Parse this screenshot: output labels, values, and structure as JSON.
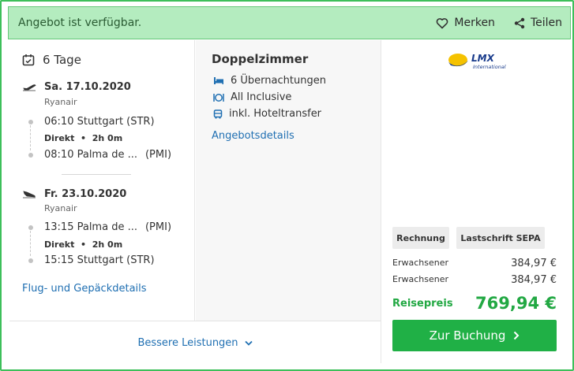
{
  "banner": {
    "title": "Angebot ist verfügbar.",
    "save_label": "Merken",
    "share_label": "Teilen"
  },
  "trip": {
    "duration": "6 Tage",
    "outbound": {
      "date": "Sa. 17.10.2020",
      "airline": "Ryanair",
      "dep_time_place": "06:10 Stuttgart (STR)",
      "direct_label": "Direkt",
      "duration": "2h 0m",
      "arr_time_place": "08:10 Palma de ...",
      "arr_code": "(PMI)"
    },
    "return": {
      "date": "Fr. 23.10.2020",
      "airline": "Ryanair",
      "dep_time_place": "13:15 Palma de ...",
      "dep_code": "(PMI)",
      "direct_label": "Direkt",
      "duration": "2h 0m",
      "arr_time_place": "15:15 Stuttgart (STR)"
    },
    "details_link": "Flug- und Gepäckdetails"
  },
  "room": {
    "title": "Doppelzimmer",
    "features": [
      "6 Übernachtungen",
      "All Inclusive",
      "inkl. Hoteltransfer"
    ],
    "details_link": "Angebotsdetails"
  },
  "operator": {
    "logo_text": "LMX",
    "logo_subtext": "International"
  },
  "payment": {
    "methods": [
      "Rechnung",
      "Lastschrift SEPA"
    ]
  },
  "prices": {
    "rows": [
      {
        "label": "Erwachsener",
        "amount": "384,97 €"
      },
      {
        "label": "Erwachsener",
        "amount": "384,97 €"
      }
    ],
    "total_label": "Reisepreis",
    "total_amount": "769,94 €"
  },
  "actions": {
    "book_label": "Zur Buchung",
    "better_label": "Bessere Leistungen"
  },
  "colors": {
    "accent_green": "#20b046",
    "banner_bg": "#b4ecbf",
    "link_blue": "#1f6fb2"
  }
}
